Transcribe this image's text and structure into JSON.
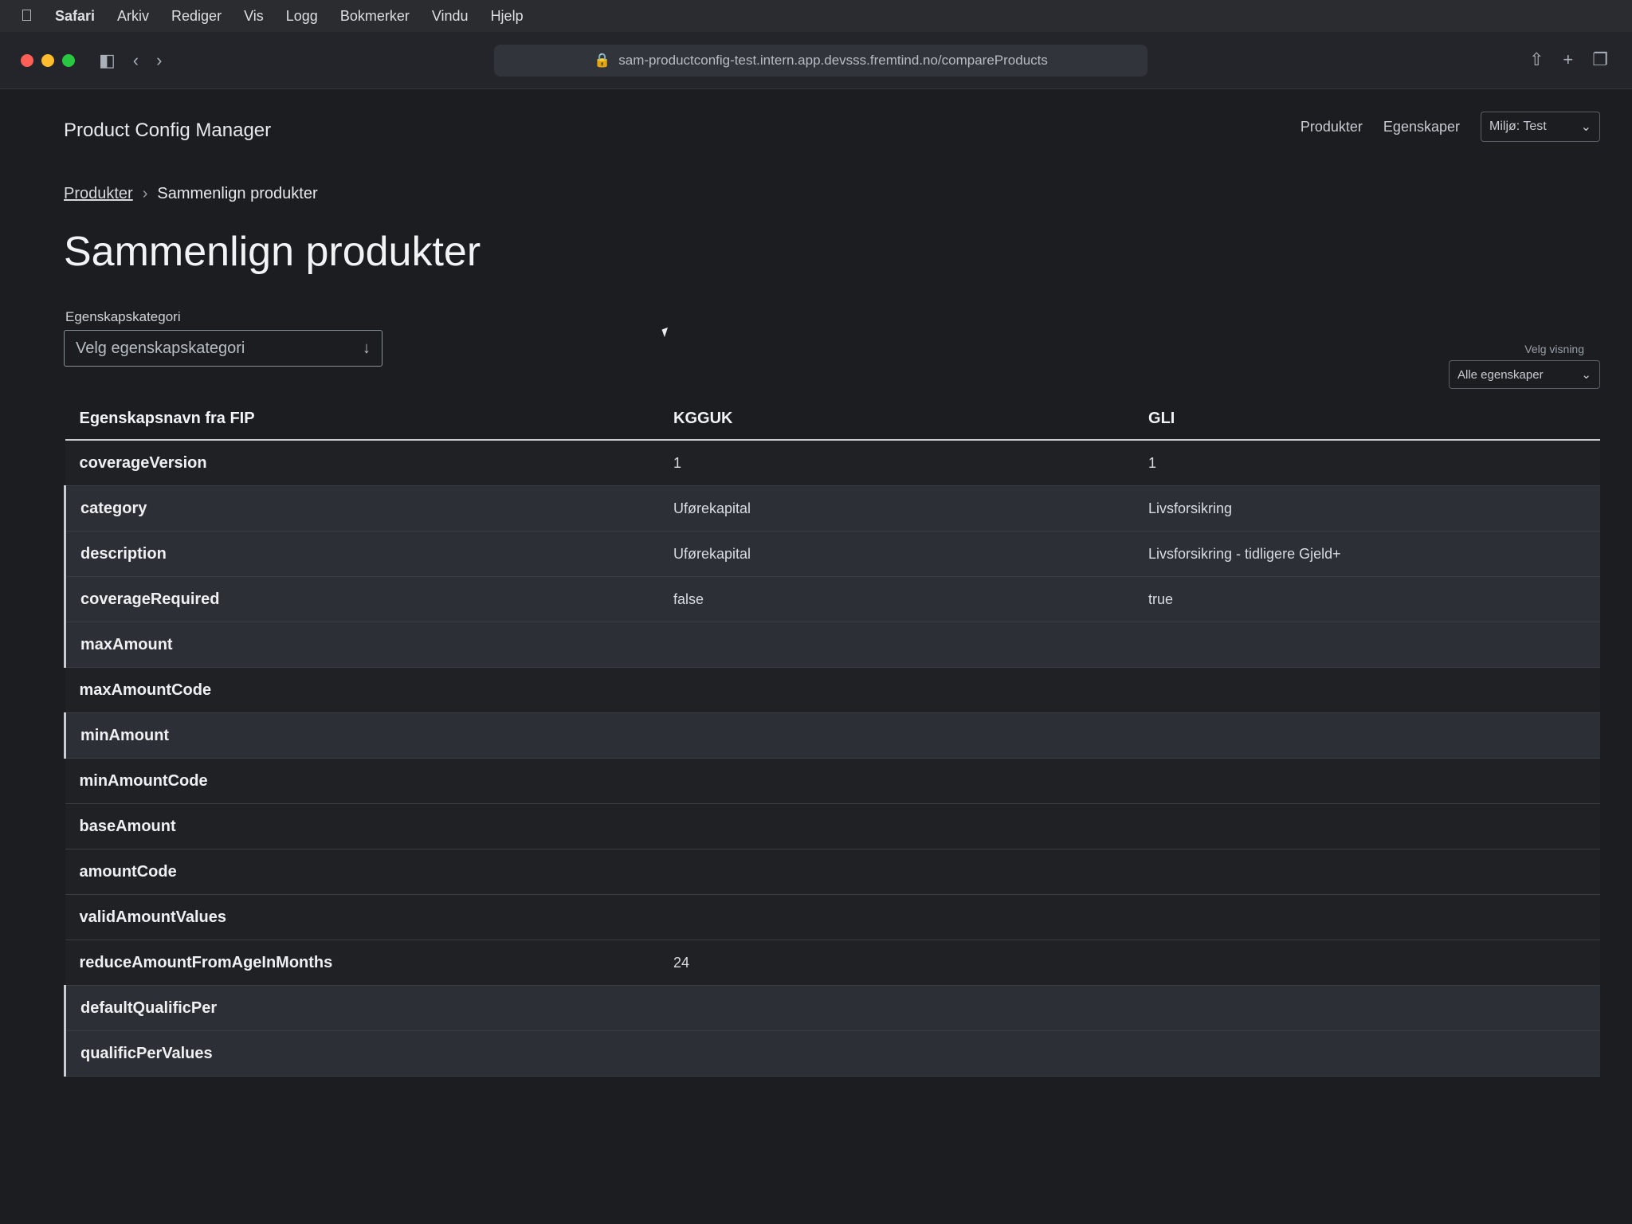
{
  "menubar": {
    "app": "Safari",
    "items": [
      "Arkiv",
      "Rediger",
      "Vis",
      "Logg",
      "Bokmerker",
      "Vindu",
      "Hjelp"
    ]
  },
  "browser": {
    "url": "sam-productconfig-test.intern.app.devsss.fremtind.no/compareProducts"
  },
  "app": {
    "title": "Product Config Manager",
    "nav": [
      "Produkter",
      "Egenskaper"
    ],
    "environment": "Miljø: Test"
  },
  "breadcrumb": {
    "parent": "Produkter",
    "separator": "›",
    "current": "Sammenlign produkter"
  },
  "page": {
    "title": "Sammenlign produkter",
    "category_label": "Egenskapskategori",
    "category_placeholder": "Velg egenskapskategori",
    "filter_label": "Velg visning",
    "filter_value": "Alle egenskaper"
  },
  "table": {
    "headers": [
      "Egenskapsnavn fra FIP",
      "KGGUK",
      "GLI"
    ],
    "rows": [
      {
        "name": "coverageVersion",
        "a": "1",
        "b": "1",
        "state": "same"
      },
      {
        "name": "category",
        "a": "Uførekapital",
        "b": "Livsforsikring",
        "state": "diff"
      },
      {
        "name": "description",
        "a": "Uførekapital",
        "b": "Livsforsikring - tidligere Gjeld+",
        "state": "diff"
      },
      {
        "name": "coverageRequired",
        "a": "false",
        "b": "true",
        "state": "diff"
      },
      {
        "name": "maxAmount",
        "a": "",
        "b": "",
        "state": "diff"
      },
      {
        "name": "maxAmountCode",
        "a": "",
        "b": "",
        "state": "same"
      },
      {
        "name": "minAmount",
        "a": "",
        "b": "",
        "state": "diff"
      },
      {
        "name": "minAmountCode",
        "a": "",
        "b": "",
        "state": "same"
      },
      {
        "name": "baseAmount",
        "a": "",
        "b": "",
        "state": "same"
      },
      {
        "name": "amountCode",
        "a": "",
        "b": "",
        "state": "same"
      },
      {
        "name": "validAmountValues",
        "a": "",
        "b": "",
        "state": "same"
      },
      {
        "name": "reduceAmountFromAgeInMonths",
        "a": "24",
        "b": "",
        "state": "same"
      },
      {
        "name": "defaultQualificPer",
        "a": "",
        "b": "",
        "state": "diff"
      },
      {
        "name": "qualificPerValues",
        "a": "",
        "b": "",
        "state": "diff"
      }
    ]
  }
}
